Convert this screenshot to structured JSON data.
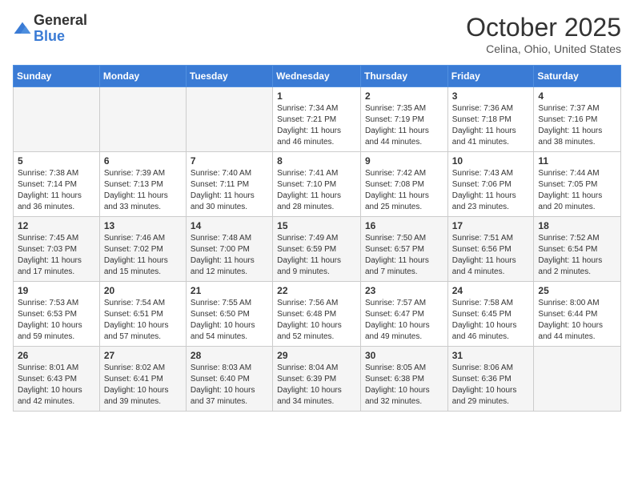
{
  "header": {
    "logo_general": "General",
    "logo_blue": "Blue",
    "month_title": "October 2025",
    "location": "Celina, Ohio, United States"
  },
  "calendar": {
    "days_of_week": [
      "Sunday",
      "Monday",
      "Tuesday",
      "Wednesday",
      "Thursday",
      "Friday",
      "Saturday"
    ],
    "weeks": [
      [
        {
          "day": "",
          "content": ""
        },
        {
          "day": "",
          "content": ""
        },
        {
          "day": "",
          "content": ""
        },
        {
          "day": "1",
          "content": "Sunrise: 7:34 AM\nSunset: 7:21 PM\nDaylight: 11 hours and 46 minutes."
        },
        {
          "day": "2",
          "content": "Sunrise: 7:35 AM\nSunset: 7:19 PM\nDaylight: 11 hours and 44 minutes."
        },
        {
          "day": "3",
          "content": "Sunrise: 7:36 AM\nSunset: 7:18 PM\nDaylight: 11 hours and 41 minutes."
        },
        {
          "day": "4",
          "content": "Sunrise: 7:37 AM\nSunset: 7:16 PM\nDaylight: 11 hours and 38 minutes."
        }
      ],
      [
        {
          "day": "5",
          "content": "Sunrise: 7:38 AM\nSunset: 7:14 PM\nDaylight: 11 hours and 36 minutes."
        },
        {
          "day": "6",
          "content": "Sunrise: 7:39 AM\nSunset: 7:13 PM\nDaylight: 11 hours and 33 minutes."
        },
        {
          "day": "7",
          "content": "Sunrise: 7:40 AM\nSunset: 7:11 PM\nDaylight: 11 hours and 30 minutes."
        },
        {
          "day": "8",
          "content": "Sunrise: 7:41 AM\nSunset: 7:10 PM\nDaylight: 11 hours and 28 minutes."
        },
        {
          "day": "9",
          "content": "Sunrise: 7:42 AM\nSunset: 7:08 PM\nDaylight: 11 hours and 25 minutes."
        },
        {
          "day": "10",
          "content": "Sunrise: 7:43 AM\nSunset: 7:06 PM\nDaylight: 11 hours and 23 minutes."
        },
        {
          "day": "11",
          "content": "Sunrise: 7:44 AM\nSunset: 7:05 PM\nDaylight: 11 hours and 20 minutes."
        }
      ],
      [
        {
          "day": "12",
          "content": "Sunrise: 7:45 AM\nSunset: 7:03 PM\nDaylight: 11 hours and 17 minutes."
        },
        {
          "day": "13",
          "content": "Sunrise: 7:46 AM\nSunset: 7:02 PM\nDaylight: 11 hours and 15 minutes."
        },
        {
          "day": "14",
          "content": "Sunrise: 7:48 AM\nSunset: 7:00 PM\nDaylight: 11 hours and 12 minutes."
        },
        {
          "day": "15",
          "content": "Sunrise: 7:49 AM\nSunset: 6:59 PM\nDaylight: 11 hours and 9 minutes."
        },
        {
          "day": "16",
          "content": "Sunrise: 7:50 AM\nSunset: 6:57 PM\nDaylight: 11 hours and 7 minutes."
        },
        {
          "day": "17",
          "content": "Sunrise: 7:51 AM\nSunset: 6:56 PM\nDaylight: 11 hours and 4 minutes."
        },
        {
          "day": "18",
          "content": "Sunrise: 7:52 AM\nSunset: 6:54 PM\nDaylight: 11 hours and 2 minutes."
        }
      ],
      [
        {
          "day": "19",
          "content": "Sunrise: 7:53 AM\nSunset: 6:53 PM\nDaylight: 10 hours and 59 minutes."
        },
        {
          "day": "20",
          "content": "Sunrise: 7:54 AM\nSunset: 6:51 PM\nDaylight: 10 hours and 57 minutes."
        },
        {
          "day": "21",
          "content": "Sunrise: 7:55 AM\nSunset: 6:50 PM\nDaylight: 10 hours and 54 minutes."
        },
        {
          "day": "22",
          "content": "Sunrise: 7:56 AM\nSunset: 6:48 PM\nDaylight: 10 hours and 52 minutes."
        },
        {
          "day": "23",
          "content": "Sunrise: 7:57 AM\nSunset: 6:47 PM\nDaylight: 10 hours and 49 minutes."
        },
        {
          "day": "24",
          "content": "Sunrise: 7:58 AM\nSunset: 6:45 PM\nDaylight: 10 hours and 46 minutes."
        },
        {
          "day": "25",
          "content": "Sunrise: 8:00 AM\nSunset: 6:44 PM\nDaylight: 10 hours and 44 minutes."
        }
      ],
      [
        {
          "day": "26",
          "content": "Sunrise: 8:01 AM\nSunset: 6:43 PM\nDaylight: 10 hours and 42 minutes."
        },
        {
          "day": "27",
          "content": "Sunrise: 8:02 AM\nSunset: 6:41 PM\nDaylight: 10 hours and 39 minutes."
        },
        {
          "day": "28",
          "content": "Sunrise: 8:03 AM\nSunset: 6:40 PM\nDaylight: 10 hours and 37 minutes."
        },
        {
          "day": "29",
          "content": "Sunrise: 8:04 AM\nSunset: 6:39 PM\nDaylight: 10 hours and 34 minutes."
        },
        {
          "day": "30",
          "content": "Sunrise: 8:05 AM\nSunset: 6:38 PM\nDaylight: 10 hours and 32 minutes."
        },
        {
          "day": "31",
          "content": "Sunrise: 8:06 AM\nSunset: 6:36 PM\nDaylight: 10 hours and 29 minutes."
        },
        {
          "day": "",
          "content": ""
        }
      ]
    ]
  }
}
